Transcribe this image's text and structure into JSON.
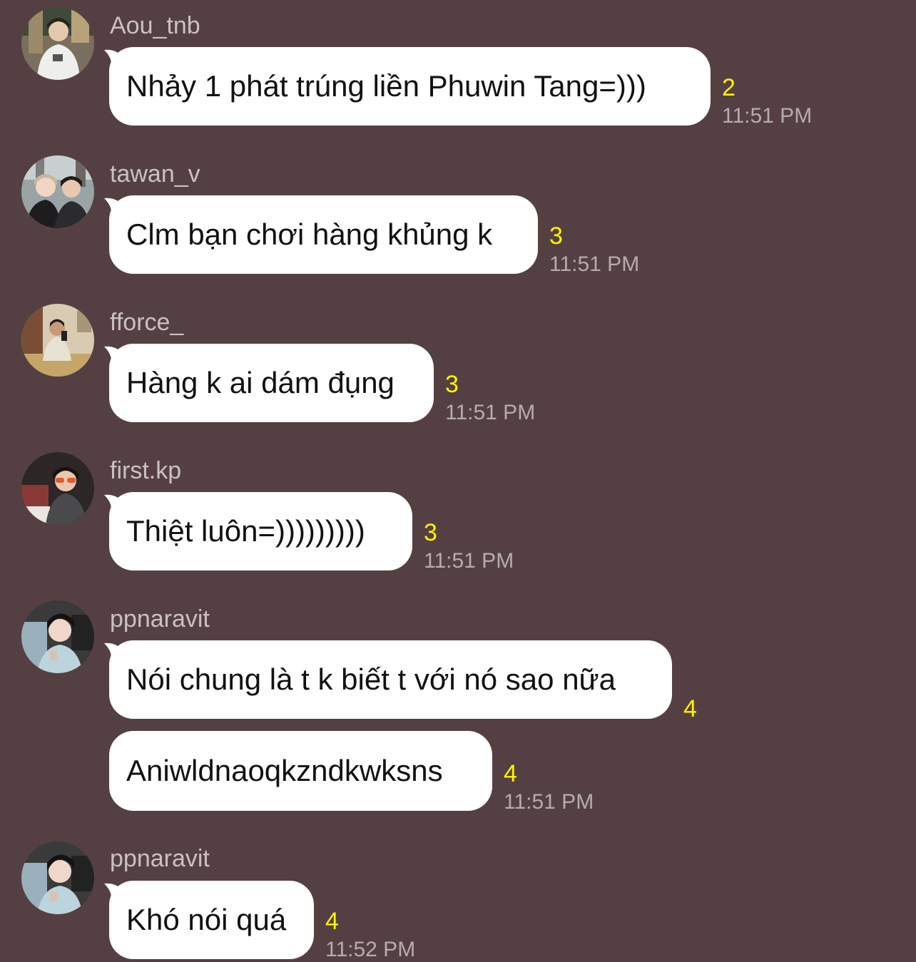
{
  "messages": [
    {
      "user": "Aou_tnb",
      "text": "Nhảy 1 phát trúng liền Phuwin Tang=)))",
      "unread": "2",
      "time": "11:51 PM"
    },
    {
      "user": "tawan_v",
      "text": "Clm bạn chơi hàng khủng k",
      "unread": "3",
      "time": "11:51 PM"
    },
    {
      "user": "fforce_",
      "text": "Hàng k ai dám đụng",
      "unread": "3",
      "time": "11:51 PM"
    },
    {
      "user": "first.kp",
      "text": "Thiệt luôn=)))))))))",
      "unread": "3",
      "time": "11:51 PM"
    },
    {
      "user": "ppnaravit",
      "text": "Nói chung là t k biết t với nó sao nữa",
      "unread": "4",
      "text2": "Aniwldnaoqkzndkwksns",
      "unread2": "4",
      "time": "11:51 PM"
    },
    {
      "user": "ppnaravit",
      "text": "Khó nói quá",
      "unread": "4",
      "time": "11:52 PM"
    }
  ],
  "colors": {
    "background": "#544042",
    "bubble": "#ffffff",
    "unread": "#fff200",
    "username": "#cbc0c1",
    "time": "#b7abac"
  }
}
